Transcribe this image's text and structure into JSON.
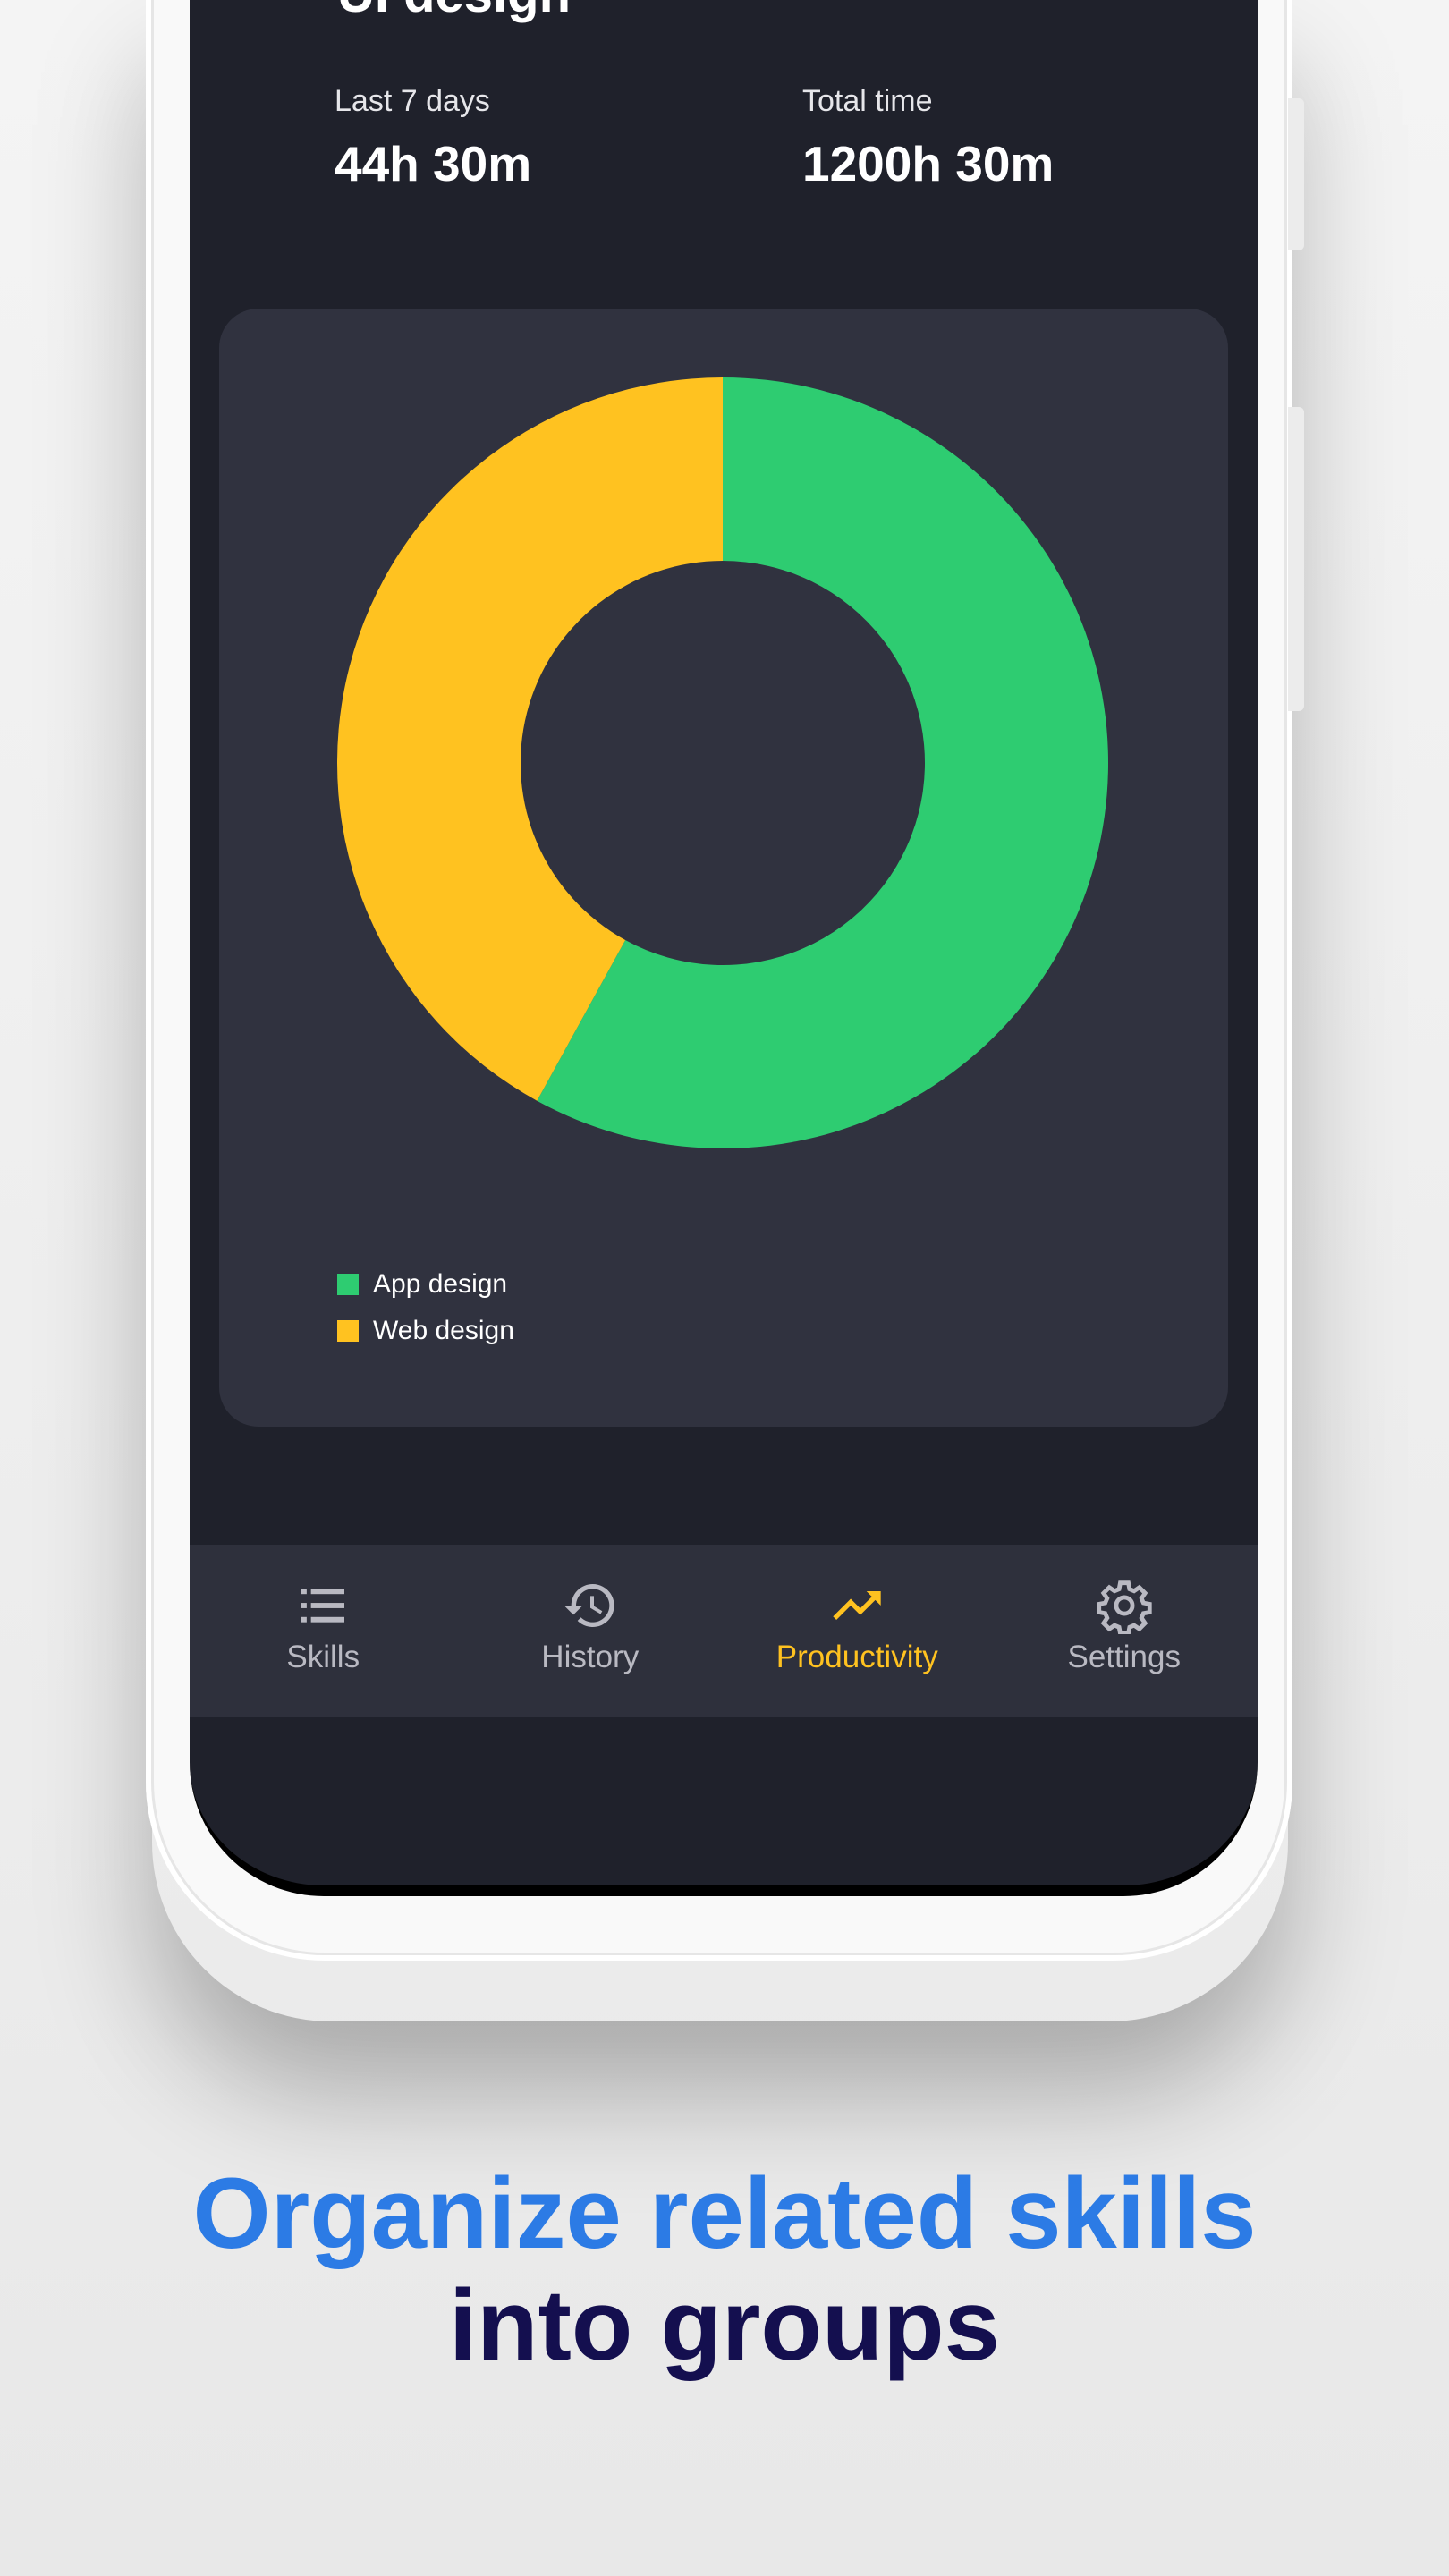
{
  "header": {
    "title_partial": "UI design",
    "stats": [
      {
        "label": "Last 7 days",
        "value": "44h 30m"
      },
      {
        "label": "Total time",
        "value": "1200h 30m"
      }
    ]
  },
  "chart_data": {
    "type": "pie",
    "style": "donut",
    "categories": [
      "App design",
      "Web design"
    ],
    "values": [
      58,
      42
    ],
    "colors": [
      "#2ecc71",
      "#ffc220"
    ],
    "legend_position": "bottom-left"
  },
  "nav": {
    "items": [
      {
        "label": "Skills",
        "icon": "list-icon"
      },
      {
        "label": "History",
        "icon": "history-icon"
      },
      {
        "label": "Productivity",
        "icon": "trending-up-icon"
      },
      {
        "label": "Settings",
        "icon": "gear-icon"
      }
    ],
    "active_index": 2,
    "active_color": "#ffc220"
  },
  "caption": {
    "line1": "Organize related skills",
    "line2": "into groups"
  }
}
